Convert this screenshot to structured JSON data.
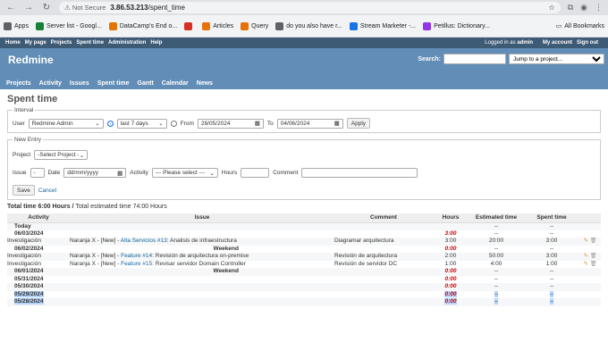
{
  "browser": {
    "security": "Not Secure",
    "url_host": "3.86.53.213",
    "url_path": "/spent_time",
    "bookmarks": [
      {
        "label": "Apps",
        "color": "#5f6368"
      },
      {
        "label": "Server list - Googl...",
        "color": "#188038"
      },
      {
        "label": "DataCamp's End o...",
        "color": "#e37400"
      },
      {
        "label": "",
        "color": "#d93025"
      },
      {
        "label": "Articles",
        "color": "#e8710a"
      },
      {
        "label": "Query",
        "color": "#e8710a"
      },
      {
        "label": "do you also have r...",
        "color": "#5f6368"
      },
      {
        "label": "Stream Marketer -...",
        "color": "#1a73e8"
      },
      {
        "label": "Petillus: Dictionary...",
        "color": "#9334e6"
      }
    ],
    "all_bookmarks": "All Bookmarks"
  },
  "top_menu": {
    "left": [
      "Home",
      "My page",
      "Projects",
      "Spent time",
      "Administration",
      "Help"
    ],
    "logged_as": "Logged in as",
    "user": "admin",
    "right": [
      "My account",
      "Sign out"
    ]
  },
  "header": {
    "title": "Redmine",
    "search_label": "Search:",
    "jump_placeholder": "Jump to a project...",
    "menu": [
      "Projects",
      "Activity",
      "Issues",
      "Spent time",
      "Gantt",
      "Calendar",
      "News"
    ]
  },
  "page": {
    "title": "Spent time",
    "interval_legend": "Interval",
    "user_label": "User",
    "user_value": "Redmine Admin",
    "period_value": "last 7 days",
    "from_label": "From",
    "from_value": "28/05/2024",
    "to_label": "To",
    "to_value": "04/06/2024",
    "apply": "Apply",
    "new_entry_legend": "New Entry",
    "project_label": "Project",
    "project_value": "-Select Project -",
    "issue_label": "Issue",
    "issue_value": "-",
    "date_label": "Date",
    "date_value": "dd/mm/yyyy",
    "activity_label": "Activity",
    "activity_value": "--- Please select ---",
    "hours_label": "Hours",
    "comment_label": "Comment",
    "save": "Save",
    "cancel": "Cancel",
    "total_time": "Total time 6:00 Hours",
    "sep": "/",
    "total_estimated": "Total estimated time 74:00 Hours"
  },
  "table": {
    "headers": [
      "Activity",
      "Issue",
      "Comment",
      "Hours",
      "Estimated time",
      "Spent time"
    ],
    "rows": [
      {
        "type": "day",
        "day": "Today",
        "hours": "",
        "est": "--",
        "spent": "--"
      },
      {
        "type": "day",
        "day": "06/03/2024",
        "hours": "3:00",
        "est": "--",
        "spent": "--"
      },
      {
        "type": "entry",
        "activity": "Investigación",
        "issue_prefix": "Naranja X - [New] -",
        "issue_link": "Alta Servicios #13",
        "issue_title": ": Analisis de infraestructura",
        "comment": "Diagramar arquitectura",
        "hours": "3:00",
        "est": "20:00",
        "spent": "3:00"
      },
      {
        "type": "day",
        "day": "06/02/2024",
        "note": "Weekend",
        "hours": "0:00",
        "est": "--",
        "spent": "--"
      },
      {
        "type": "entry",
        "activity": "Investigación",
        "issue_prefix": "Naranja X - [New] -",
        "issue_link": "Feature #14",
        "issue_title": ": Revisión de arquitectura on-premise",
        "comment": "Revisión de arquitectura",
        "hours": "2:00",
        "est": "50:00",
        "spent": "3:00"
      },
      {
        "type": "entry",
        "activity": "Investigación",
        "issue_prefix": "Naranja X - [New] -",
        "issue_link": "Feature #15",
        "issue_title": ": Revisar servidor Domain Controller",
        "comment": "Revisión de servidor DC",
        "hours": "1:00",
        "est": "4:00",
        "spent": "1:00"
      },
      {
        "type": "day",
        "day": "06/01/2024",
        "note": "Weekend",
        "hours": "0:00",
        "est": "--",
        "spent": "--"
      },
      {
        "type": "day",
        "day": "05/31/2024",
        "hours": "0:00",
        "est": "--",
        "spent": "--"
      },
      {
        "type": "day",
        "day": "05/30/2024",
        "hours": "0:00",
        "est": "--",
        "spent": "--"
      },
      {
        "type": "day",
        "day": "05/29/2024",
        "hours": "0:00",
        "est": "--",
        "spent": "--",
        "selected": true
      },
      {
        "type": "day",
        "day": "05/28/2024",
        "hours": "0:00",
        "est": "--",
        "spent": "--",
        "selected": true
      }
    ]
  }
}
